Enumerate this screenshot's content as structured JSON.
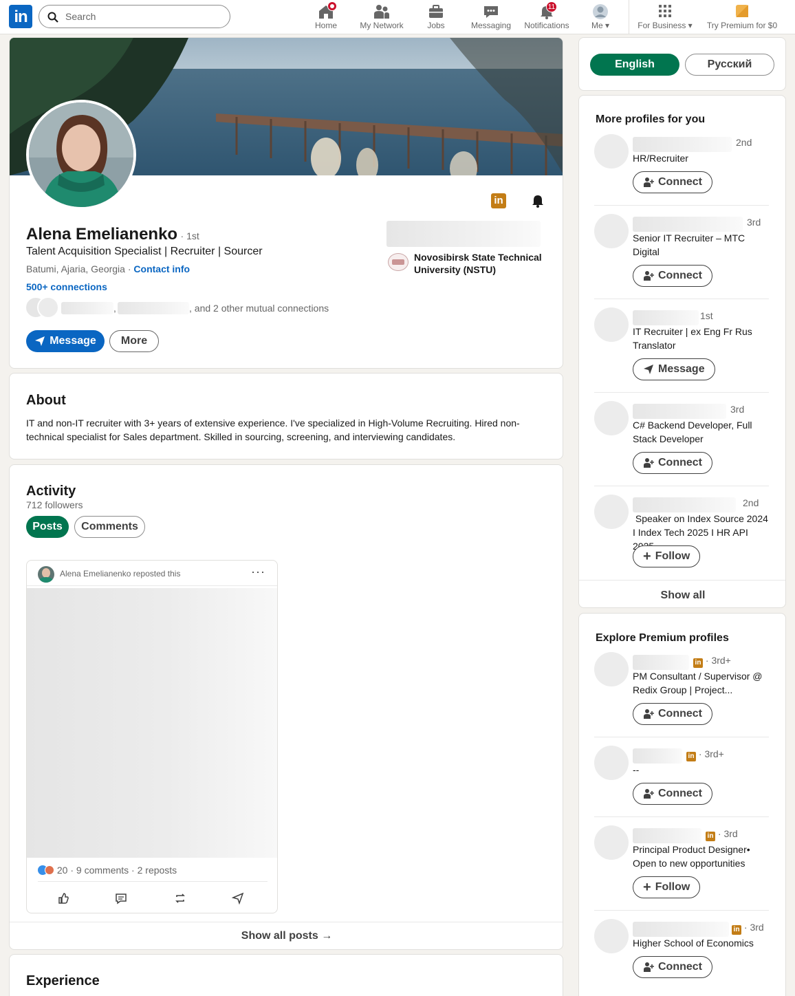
{
  "nav": {
    "logo": "in",
    "search_placeholder": "Search",
    "items": [
      {
        "label": "Home"
      },
      {
        "label": "My Network"
      },
      {
        "label": "Jobs"
      },
      {
        "label": "Messaging"
      },
      {
        "label": "Notifications",
        "badge": "11"
      },
      {
        "label": "Me"
      },
      {
        "label": "For Business"
      },
      {
        "label": "Try Premium for $0"
      }
    ]
  },
  "profile": {
    "name": "Alena Emelianenko",
    "degree": "· 1st",
    "headline": "Talent Acquisition Specialist | Recruiter | Sourcer",
    "location": "Batumi, Ajaria, Georgia",
    "contact_info": "Contact info",
    "connections": "500+ connections",
    "mutual_sep": ",",
    "mutual_text": ", and 2 other mutual connections",
    "school": "Novosibirsk State Technical University (NSTU)",
    "message_btn": "Message",
    "more_btn": "More"
  },
  "about": {
    "title": "About",
    "text": "IT and non-IT recruiter with 3+ years of extensive experience. I've specialized in High-Volume Recruiting. Hired non-technical specialist for Sales department. Skilled in sourcing, screening, and interviewing candidates."
  },
  "activity": {
    "title": "Activity",
    "followers": "712 followers",
    "tab_posts": "Posts",
    "tab_comments": "Comments",
    "post_header": "Alena Emelianenko reposted this",
    "reactions": "20",
    "stats": "· 9 comments · 2 reposts",
    "show_all": "Show all posts"
  },
  "experience": {
    "title": "Experience"
  },
  "language": {
    "english": "English",
    "russian": "Русский"
  },
  "more_profiles": {
    "title": "More profiles for you",
    "items": [
      {
        "degree": "2nd",
        "headline": "HR/Recruiter",
        "action": "Connect"
      },
      {
        "degree": "3rd",
        "headline": "Senior IT Recruiter – MTC Digital",
        "action": "Connect"
      },
      {
        "degree": "1st",
        "headline": "IT Recruiter | ex Eng Fr Rus Translator",
        "action": "Message"
      },
      {
        "degree": "3rd",
        "headline": "C# Backend Developer, Full Stack Developer",
        "action": "Connect"
      },
      {
        "degree": "2nd",
        "headline": " Speaker on Index Source 2024 I Index Tech 2025 I HR API 2025",
        "action": "Follow"
      }
    ],
    "show_all": "Show all"
  },
  "premium": {
    "title": "Explore Premium profiles",
    "items": [
      {
        "degree": "· 3rd+",
        "headline": "PM Consultant / Supervisor @ Redix Group | Project...",
        "action": "Connect"
      },
      {
        "degree": "· 3rd+",
        "headline": "--",
        "action": "Connect"
      },
      {
        "degree": "· 3rd",
        "headline": "Principal Product Designer• Open to new opportunities",
        "action": "Follow"
      },
      {
        "degree": "· 3rd",
        "headline": "Higher School of Economics",
        "action": "Connect"
      }
    ]
  },
  "colors": {
    "brand": "#0a66c2",
    "green": "#01754f",
    "notify": "#cb112d",
    "premium": "#c37d16"
  }
}
